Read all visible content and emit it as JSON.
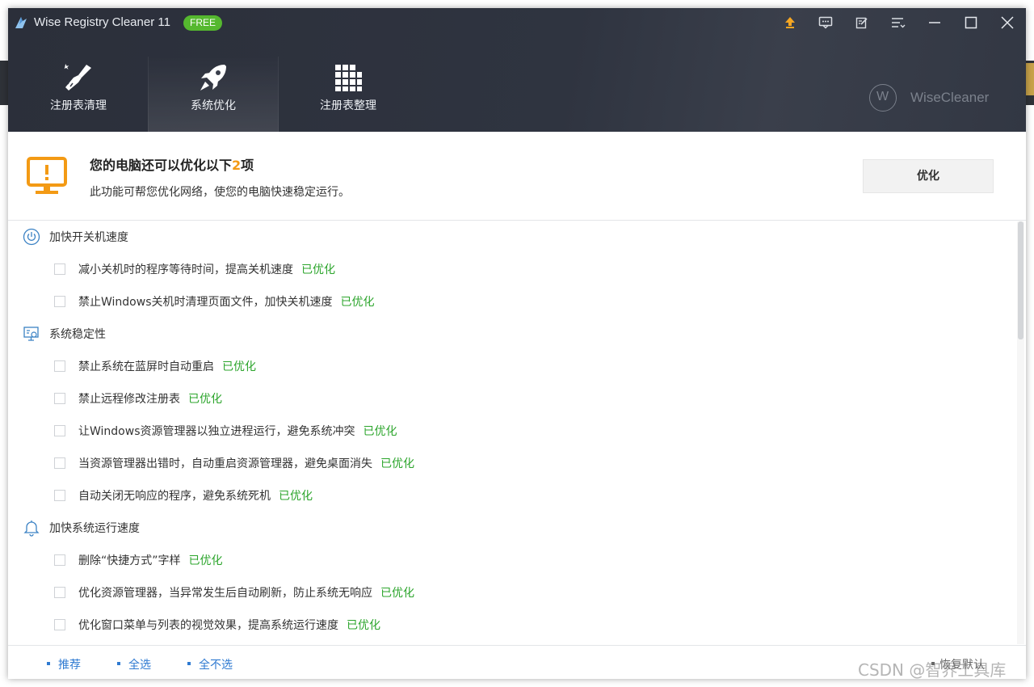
{
  "window": {
    "title": "Wise Registry Cleaner 11",
    "badge": "FREE"
  },
  "titlebar_icons": [
    "upgrade-arrow-icon",
    "feedback-icon",
    "edit-icon",
    "menu-icon",
    "minimize-icon",
    "maximize-icon",
    "close-icon"
  ],
  "nav": {
    "tabs": [
      {
        "label": "注册表清理",
        "icon": "broom-icon"
      },
      {
        "label": "系统优化",
        "icon": "rocket-icon",
        "active": true
      },
      {
        "label": "注册表整理",
        "icon": "grid-blocks-icon"
      }
    ]
  },
  "brand": {
    "letter": "W",
    "name": "WiseCleaner"
  },
  "summary": {
    "title_prefix": "您的电脑还可以优化以下",
    "count": "2",
    "title_suffix": "项",
    "subtitle": "此功能可帮您优化网络，使您的电脑快速稳定运行。",
    "button": "优化"
  },
  "status_optimized": "已优化",
  "categories": [
    {
      "label": "加快开关机速度",
      "icon": "power-icon",
      "items": [
        "减小关机时的程序等待时间，提高关机速度",
        "禁止Windows关机时清理页面文件，加快关机速度"
      ]
    },
    {
      "label": "系统稳定性",
      "icon": "system-monitor-icon",
      "items": [
        "禁止系统在蓝屏时自动重启",
        "禁止远程修改注册表",
        "让Windows资源管理器以独立进程运行，避免系统冲突",
        "当资源管理器出错时，自动重启资源管理器，避免桌面消失",
        "自动关闭无响应的程序，避免系统死机"
      ]
    },
    {
      "label": "加快系统运行速度",
      "icon": "bell-icon",
      "items": [
        "删除“快捷方式”字样",
        "优化资源管理器，当异常发生后自动刷新，防止系统无响应",
        "优化窗口菜单与列表的视觉效果，提高系统运行速度"
      ]
    }
  ],
  "footer": {
    "recommend": "推荐",
    "select_all": "全选",
    "select_none": "全不选",
    "restore": "恢复默认"
  },
  "watermark": "CSDN @智界工具库",
  "colors": {
    "header_bg": "#2f3440",
    "accent_green": "#2ca52c",
    "accent_orange": "#f39a14",
    "link_blue": "#2f7ad1",
    "badge_green": "#55b82f"
  }
}
